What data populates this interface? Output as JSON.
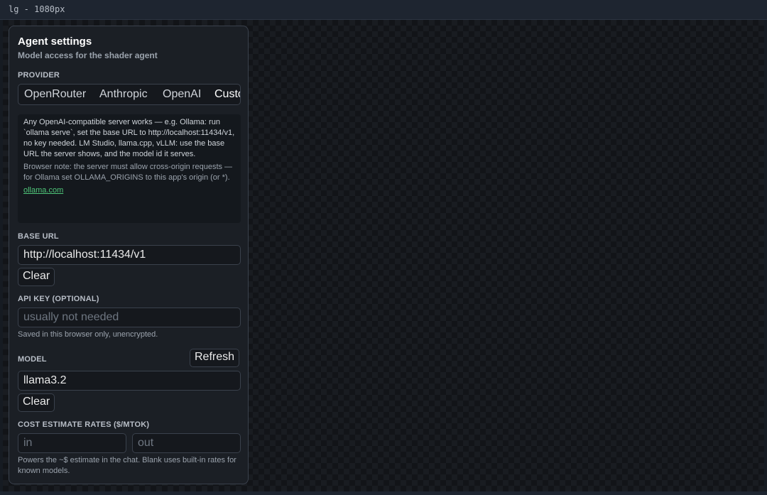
{
  "window": {
    "title": "lg - 1080px"
  },
  "panel": {
    "title": "Agent settings",
    "subtitle": "Model access for the shader agent",
    "provider": {
      "label": "PROVIDER",
      "tabs": [
        "OpenRouter",
        "Anthropic",
        "OpenAI",
        "Custom"
      ],
      "selected": "Custom"
    },
    "info": {
      "text": "Any OpenAI-compatible server works — e.g. Ollama: run `ollama serve`, set the base URL to http://localhost:11434/v1, no key needed. LM Studio, llama.cpp, vLLM: use the base URL the server shows, and the model id it serves.",
      "note": "Browser note: the server must allow cross-origin requests — for Ollama set OLLAMA_ORIGINS to this app's origin (or *).",
      "link": "ollama.com"
    },
    "base_url": {
      "label": "BASE URL",
      "value": "http://localhost:11434/v1",
      "clear": "Clear"
    },
    "api_key": {
      "label": "API KEY (OPTIONAL)",
      "value": "",
      "placeholder": "usually not needed",
      "hint": "Saved in this browser only, unencrypted."
    },
    "model": {
      "label": "MODEL",
      "refresh": "Refresh",
      "value": "llama3.2",
      "clear": "Clear"
    },
    "cost": {
      "label": "COST ESTIMATE RATES ($/MTOK)",
      "in_placeholder": "in",
      "out_placeholder": "out",
      "hint": "Powers the ~$ estimate in the chat. Blank uses built-in rates for known models."
    }
  },
  "colors": {
    "background": "#161b22",
    "panel": "#1b1f25",
    "border": "#3a414c",
    "link": "#4fc77a"
  }
}
